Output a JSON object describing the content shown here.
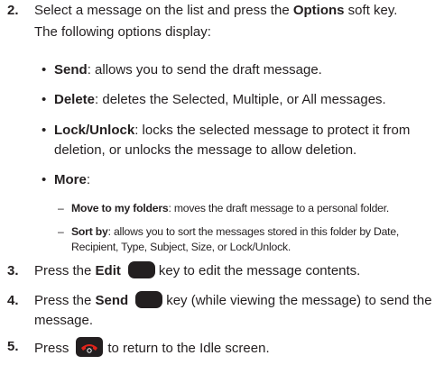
{
  "step2": {
    "number": "2.",
    "text_a": "Select a message on the list and press the ",
    "bold": "Options",
    "text_b": " soft key.",
    "line2": "The following options display:"
  },
  "bullets": [
    {
      "marker": "•",
      "term": "Send",
      "desc": ": allows you to send the draft message."
    },
    {
      "marker": "•",
      "term": "Delete",
      "desc": ": deletes the Selected, Multiple, or All messages."
    },
    {
      "marker": "•",
      "term": "Lock/Unlock",
      "desc": ": locks the selected message to protect it from deletion, or unlocks the message to allow deletion."
    },
    {
      "marker": "•",
      "term": "More",
      "desc": ":"
    }
  ],
  "sub_bullets": [
    {
      "marker": "–",
      "term": "Move to my folders",
      "desc": ": moves the draft message to a personal folder."
    },
    {
      "marker": "–",
      "term": "Sort by",
      "desc": ": allows you to sort the messages stored in this folder by Date, Recipient, Type, Subject, Size, or Lock/Unlock."
    }
  ],
  "step3": {
    "number": "3.",
    "text_a": "Press the ",
    "bold": "Edit",
    "text_b": "key to edit the message contents.",
    "key_icon": "soft-key-icon"
  },
  "step4": {
    "number": "4.",
    "text_a": "Press the ",
    "bold": "Send",
    "text_b": "key (while viewing the message) to send the message.",
    "key_icon": "soft-key-icon"
  },
  "step5": {
    "number": "5.",
    "text_a": "Press",
    "text_b": "to return to the Idle screen.",
    "key_icon": "end-key-icon"
  },
  "colors": {
    "text": "#231f20",
    "key_fill": "#231f20",
    "end_key_accent": "#e2231a"
  }
}
